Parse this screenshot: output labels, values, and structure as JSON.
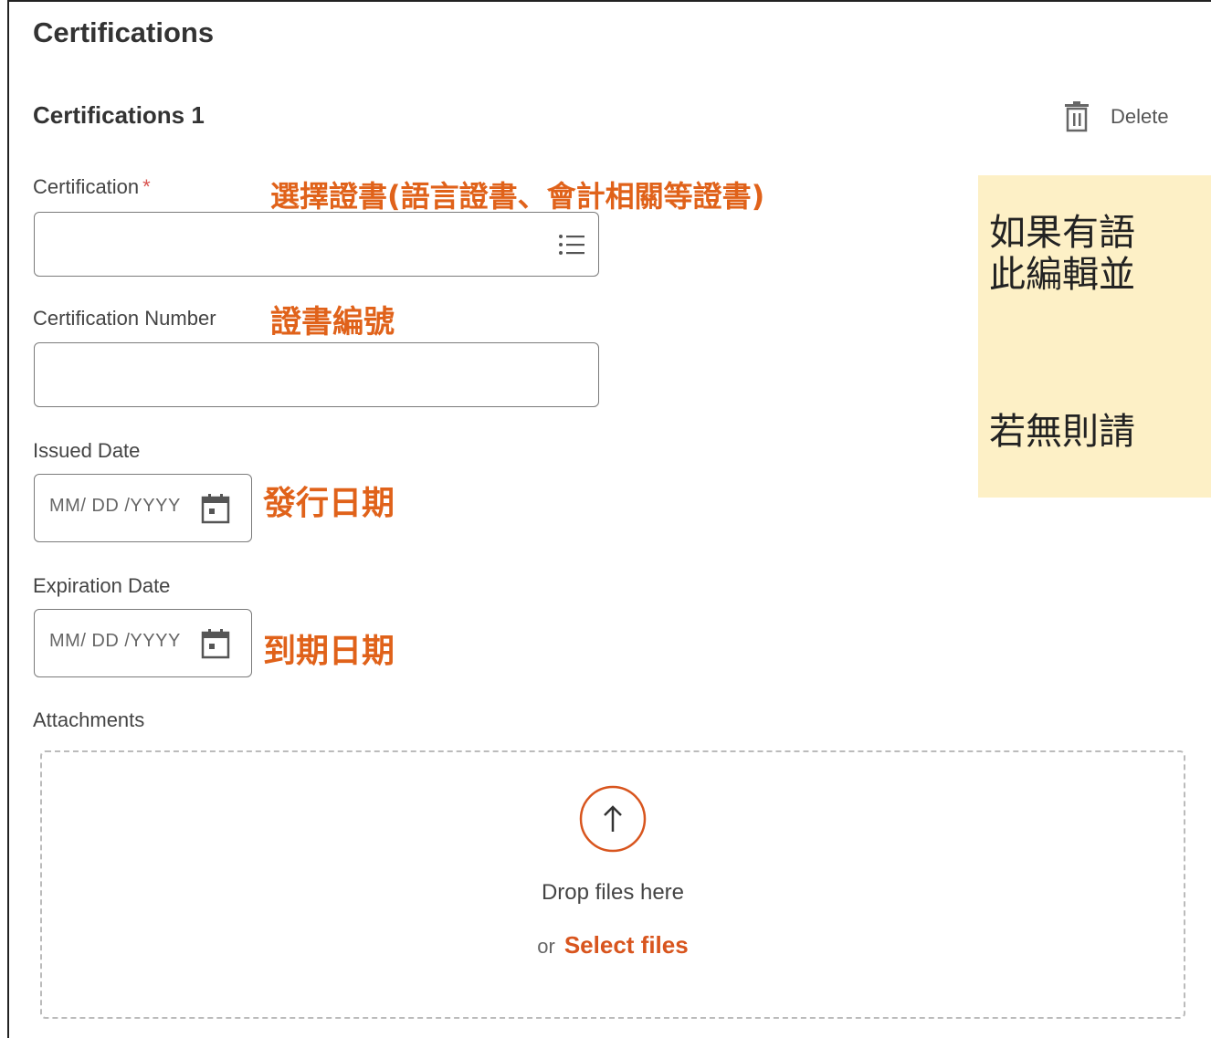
{
  "section": {
    "title": "Certifications",
    "subtitle": "Certifications 1",
    "delete_label": "Delete"
  },
  "fields": {
    "certification": {
      "label": "Certification",
      "required_mark": "*",
      "annotation": "選擇證書(語言證書、會計相關等證書)",
      "value": ""
    },
    "certification_number": {
      "label": "Certification Number",
      "annotation": "證書編號",
      "value": ""
    },
    "issued_date": {
      "label": "Issued Date",
      "placeholder": "MM/ DD /YYYY",
      "annotation": "發行日期"
    },
    "expiration_date": {
      "label": "Expiration Date",
      "placeholder": "MM/ DD /YYYY",
      "annotation": "到期日期"
    }
  },
  "attachments": {
    "label": "Attachments",
    "drop_text": "Drop files here",
    "or_text": "or",
    "select_label": "Select files"
  },
  "note": {
    "line1": "如果有語",
    "line2": "此編輯並",
    "line3": "若無則請"
  },
  "colors": {
    "accent": "#d8551e",
    "annotation": "#e0621a",
    "note_bg": "#fdf0c6",
    "required": "#d9534f"
  },
  "icons": {
    "delete": "trash-icon",
    "certification_prompt": "list-icon",
    "date": "calendar-icon",
    "upload": "upload-arrow-icon"
  }
}
